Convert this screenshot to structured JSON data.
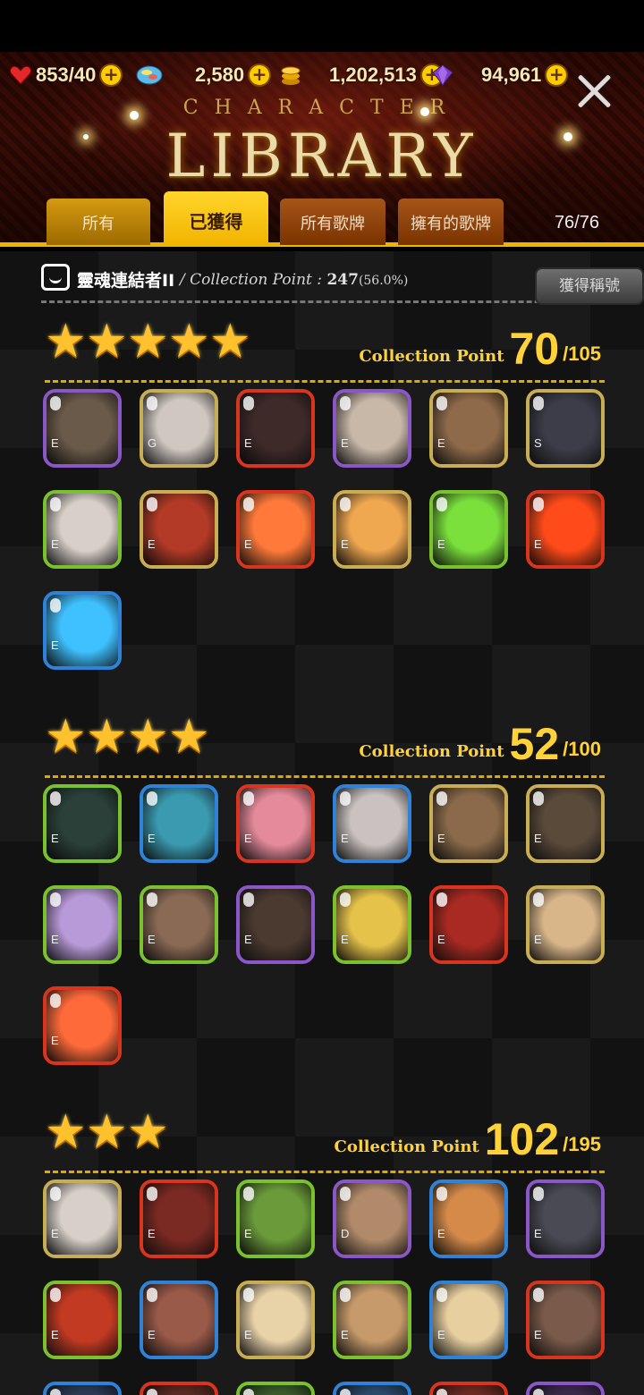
{
  "resources": {
    "stamina": "853",
    "stamina_max": "/40",
    "gems": "2,580",
    "gold": "1,202,513",
    "soul": "94,961"
  },
  "header": {
    "subtitle": "CHARACTER",
    "title": "LIBRARY"
  },
  "tabs": {
    "all": "所有",
    "owned": "已獲得",
    "all_cards": "所有歌牌",
    "owned_cards": "擁有的歌牌"
  },
  "count": "76/76",
  "collection_title": {
    "name": "靈魂連結者II",
    "cp_label": "/ Collection Point :",
    "cp_value": "247",
    "cp_percent": "(56.0%)",
    "get_title_button": "獲得稱號"
  },
  "sections": [
    {
      "stars": "★★★★★",
      "cp_label": "Collection Point",
      "cp_value": "70",
      "cp_total": "/105",
      "cards": [
        {
          "border": "purple",
          "grade": "E",
          "color": "#6a5a4a"
        },
        {
          "border": "gold",
          "grade": "G",
          "color": "#cfc7c0"
        },
        {
          "border": "red",
          "grade": "E",
          "color": "#3f2a2a"
        },
        {
          "border": "purple",
          "grade": "E",
          "color": "#c8b8a8"
        },
        {
          "border": "gold",
          "grade": "E",
          "color": "#8e6a4a"
        },
        {
          "border": "gold",
          "grade": "S",
          "color": "#3d3d4a"
        },
        {
          "border": "green",
          "grade": "E",
          "color": "#d8d0c8"
        },
        {
          "border": "gold",
          "grade": "E",
          "color": "#b23a26"
        },
        {
          "border": "red",
          "grade": "E",
          "color": "#ff7a3a"
        },
        {
          "border": "gold",
          "grade": "E",
          "color": "#f0a850"
        },
        {
          "border": "green",
          "grade": "E",
          "color": "#7be03c"
        },
        {
          "border": "red",
          "grade": "E",
          "color": "#ff4a1a"
        },
        {
          "border": "blue",
          "grade": "E",
          "color": "#3fc0ff"
        }
      ]
    },
    {
      "stars": "★★★★",
      "cp_label": "Collection Point",
      "cp_value": "52",
      "cp_total": "/100",
      "cards": [
        {
          "border": "green",
          "grade": "E",
          "color": "#2a4038"
        },
        {
          "border": "blue",
          "grade": "E",
          "color": "#3a9ab0"
        },
        {
          "border": "red",
          "grade": "E",
          "color": "#e58a9a"
        },
        {
          "border": "blue",
          "grade": "E",
          "color": "#c9c2c0"
        },
        {
          "border": "gold",
          "grade": "E",
          "color": "#8a6a4a"
        },
        {
          "border": "gold",
          "grade": "E",
          "color": "#5a4a3a"
        },
        {
          "border": "green",
          "grade": "E",
          "color": "#b99ad8"
        },
        {
          "border": "green",
          "grade": "E",
          "color": "#8a6a55"
        },
        {
          "border": "purple",
          "grade": "E",
          "color": "#4a3a30"
        },
        {
          "border": "green",
          "grade": "E",
          "color": "#e5c24a"
        },
        {
          "border": "red",
          "grade": "E",
          "color": "#a82a22"
        },
        {
          "border": "gold",
          "grade": "E",
          "color": "#d9b68a"
        },
        {
          "border": "red",
          "grade": "E",
          "color": "#ff6a3a"
        }
      ]
    },
    {
      "stars": "★★★",
      "cp_label": "Collection Point",
      "cp_value": "102",
      "cp_total": "/195",
      "cards": [
        {
          "border": "gold",
          "grade": "E",
          "color": "#d8d0c8"
        },
        {
          "border": "red",
          "grade": "E",
          "color": "#7a2a22"
        },
        {
          "border": "green",
          "grade": "E",
          "color": "#6a9a3a"
        },
        {
          "border": "purple",
          "grade": "D",
          "color": "#b08a6a"
        },
        {
          "border": "blue",
          "grade": "E",
          "color": "#d58a4a"
        },
        {
          "border": "purple",
          "grade": "E",
          "color": "#4a4a55"
        },
        {
          "border": "green",
          "grade": "E",
          "color": "#c23a22"
        },
        {
          "border": "blue",
          "grade": "E",
          "color": "#9a5a4a"
        },
        {
          "border": "gold",
          "grade": "E",
          "color": "#e8d2a8"
        },
        {
          "border": "green",
          "grade": "E",
          "color": "#c69a6a"
        },
        {
          "border": "blue",
          "grade": "E",
          "color": "#e8cfa0"
        },
        {
          "border": "red",
          "grade": "E",
          "color": "#7a5a4a"
        },
        {
          "border": "blue",
          "grade": "",
          "color": "#2a3a55"
        },
        {
          "border": "red",
          "grade": "",
          "color": "#5a2a22"
        },
        {
          "border": "green",
          "grade": "",
          "color": "#3a5a2a"
        },
        {
          "border": "blue",
          "grade": "",
          "color": "#2a4a6a"
        },
        {
          "border": "red",
          "grade": "",
          "color": "#6a2a22"
        },
        {
          "border": "purple",
          "grade": "",
          "color": "#3a2a4a"
        }
      ]
    }
  ]
}
